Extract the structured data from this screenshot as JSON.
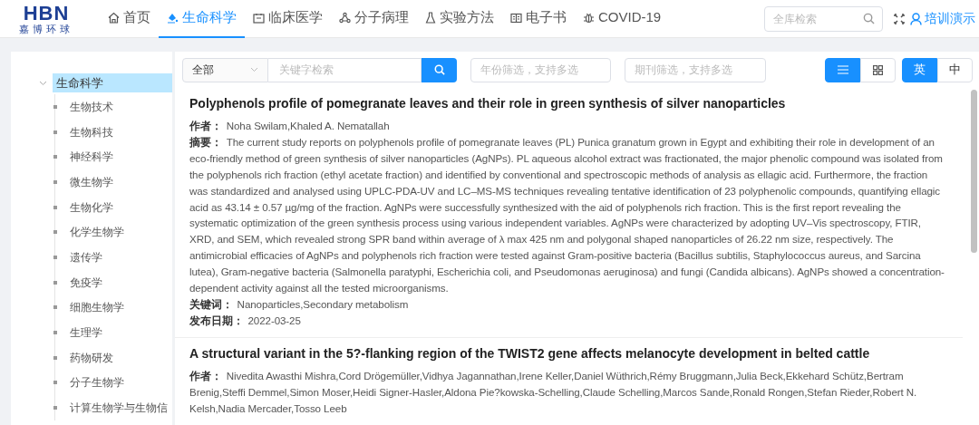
{
  "logo": {
    "mark": "HBN",
    "subtitle": "嘉博环球"
  },
  "nav": [
    {
      "label": "首页",
      "selected": false
    },
    {
      "label": "生命科学",
      "selected": true
    },
    {
      "label": "临床医学",
      "selected": false
    },
    {
      "label": "分子病理",
      "selected": false
    },
    {
      "label": "实验方法",
      "selected": false
    },
    {
      "label": "电子书",
      "selected": false
    },
    {
      "label": "COVID-19",
      "selected": false
    }
  ],
  "global_search": {
    "placeholder": "全库检索"
  },
  "user": {
    "label": "培训演示"
  },
  "tree": {
    "label": "生命科学",
    "selected": true,
    "expanded": true,
    "children": [
      {
        "label": "生物技术"
      },
      {
        "label": "生物科技"
      },
      {
        "label": "神经科学"
      },
      {
        "label": "微生物学"
      },
      {
        "label": "生物化学"
      },
      {
        "label": "化学生物学"
      },
      {
        "label": "遗传学"
      },
      {
        "label": "免疫学"
      },
      {
        "label": "细胞生物学"
      },
      {
        "label": "生理学"
      },
      {
        "label": "药物研发"
      },
      {
        "label": "分子生物学"
      },
      {
        "label": "计算生物学与生物信"
      }
    ]
  },
  "filters": {
    "scope": "全部",
    "keyword_placeholder": "关键字检索",
    "year_placeholder": "年份筛选，支持多选",
    "journal_placeholder": "期刊筛选，支持多选"
  },
  "view_modes": [
    {
      "kind": "list",
      "selected": true
    },
    {
      "kind": "grid",
      "selected": false
    }
  ],
  "languages": [
    {
      "label": "英",
      "selected": true
    },
    {
      "label": "中",
      "selected": false
    }
  ],
  "articles": [
    {
      "title": "Polyphenols profile of pomegranate leaves and their role in green synthesis of silver nanoparticles",
      "fields": [
        {
          "label": "作者：",
          "value": "Noha Swilam,Khaled A. Nematallah"
        },
        {
          "label": "摘要：",
          "value": "The current study reports on polyphenols profile of pomegranate leaves (PL) Punica granatum grown in Egypt and exhibiting their role in development of an eco-friendly method of green synthesis of silver nanoparticles (AgNPs). PL aqueous alcohol extract was fractionated, the major phenolic compound was isolated from the polyphenols rich fraction (ethyl acetate fraction) and identified by conventional and spectroscopic methods of analysis as ellagic acid. Furthermore, the fraction was standardized and analysed using UPLC-PDA-UV and LC–MS-MS techniques revealing tentative identification of 23 polyphenolic compounds, quantifying ellagic acid as 43.14 ± 0.57 µg/mg of the fraction. AgNPs were successfully synthesized with the aid of polyphenols rich fraction. This is the first report revealing the systematic optimization of the green synthesis process using various independent variables. AgNPs were characterized by adopting UV–Vis spectroscopy, FTIR, XRD, and SEM, which revealed strong SPR band within average of λ max 425 nm and polygonal shaped nanoparticles of 26.22 nm size, respectively. The antimicrobial efficacies of AgNPs and polyphenols rich fraction were tested against Gram-positive bacteria (Bacillus subtilis, Staphylococcus aureus, and Sarcina lutea), Gram-negative bacteria (Salmonella paratyphi, Escherichia coli, and Pseudomonas aeruginosa) and fungi (Candida albicans). AgNPs showed a concentration-dependent activity against all the tested microorganisms."
        },
        {
          "label": "关键词：",
          "value": "Nanoparticles,Secondary metabolism"
        },
        {
          "label": "发布日期：",
          "value": "2022-03-25"
        }
      ]
    },
    {
      "title": "A structural variant in the 5?-flanking region of the TWIST2 gene affects melanocyte development in belted cattle",
      "fields": [
        {
          "label": "作者：",
          "value": "Nivedita Awasthi Mishra,Cord Drögemüller,Vidhya Jagannathan,Irene Keller,Daniel Wüthrich,Rémy Bruggmann,Julia Beck,Ekkehard Schütz,Bertram Brenig,Steffi Demmel,Simon Moser,Heidi Signer-Hasler,Aldona Pie?kowska-Schelling,Claude Schelling,Marcos Sande,Ronald Rongen,Stefan Rieder,Robert N. Kelsh,Nadia Mercader,Tosso Leeb"
        }
      ]
    }
  ]
}
